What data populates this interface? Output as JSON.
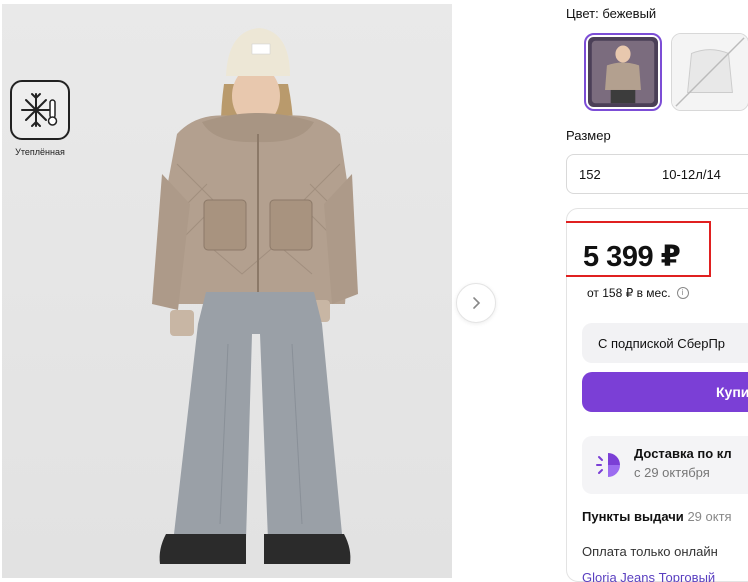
{
  "product": {
    "badge_label": "Утеплённая",
    "badge_icon": "snowflake-thermometer-icon",
    "gallery_next_icon": "chevron-right-icon"
  },
  "options": {
    "color_label": "Цвет: бежевый",
    "size_label": "Размер",
    "size_value": "152",
    "size_age": "10-12л/14"
  },
  "pricing": {
    "price": "5 399 ₽",
    "installment": "от 158 ₽ в мес.",
    "subscription_button": "С подпиской СберПр",
    "buy_button": "Купи",
    "accent_color": "#7b3fd6",
    "highlight_color": "#e02020"
  },
  "delivery": {
    "title": "Доставка по кл",
    "date": "с 29 октября",
    "pickup_label": "Пункты выдачи",
    "pickup_date": "29 октя",
    "payment_note": "Оплата только онлайн",
    "seller_partial": "Gloria Jeans Торговый"
  }
}
